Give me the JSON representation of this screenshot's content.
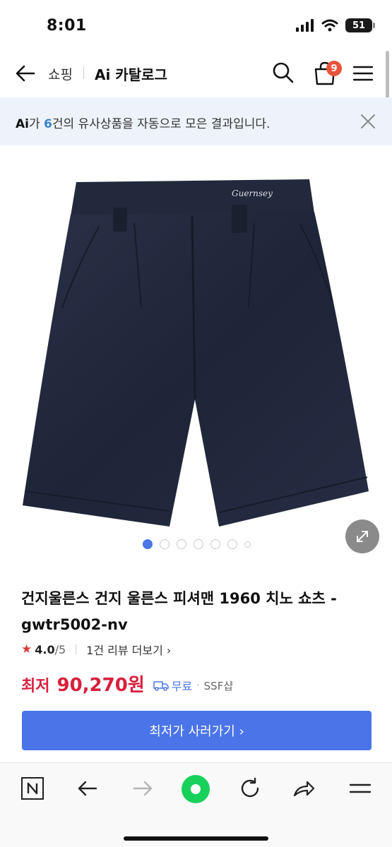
{
  "status_bar": {
    "time": "8:01",
    "battery": "51"
  },
  "header": {
    "crumb_shopping": "쇼핑",
    "crumb_catalog": "Ai 카탈로그",
    "cart_count": "9"
  },
  "ai_banner": {
    "logo": "Ai",
    "text_before": "가 ",
    "count": "6",
    "text_after": "건의 유사상품을 자동으로 모은 결과입니다."
  },
  "gallery": {
    "image_brand_text": "Guernsey",
    "dot_count": 7,
    "active_index": 0
  },
  "product": {
    "title": "건지울른스 건지 울른스 피셔맨 1960 치노 쇼츠 - gwtr5002-nv",
    "rating": "4.0",
    "rating_max": "/5",
    "review_link": "1건 리뷰 더보기 ›",
    "price_label": "최저",
    "price": "90,270원",
    "shipping": "무료",
    "shop": "SSF샵",
    "buy_button": "최저가 사러가기 ›"
  },
  "colors": {
    "accent": "#4a74e8",
    "price": "#d8203d",
    "badge": "#e8533a",
    "green_button": "#17d15b"
  },
  "toolbar": {
    "icons": [
      "naver-n-icon",
      "back-arrow-icon",
      "forward-arrow-icon",
      "green-circle-icon",
      "refresh-icon",
      "share-icon",
      "menu-icon"
    ]
  }
}
